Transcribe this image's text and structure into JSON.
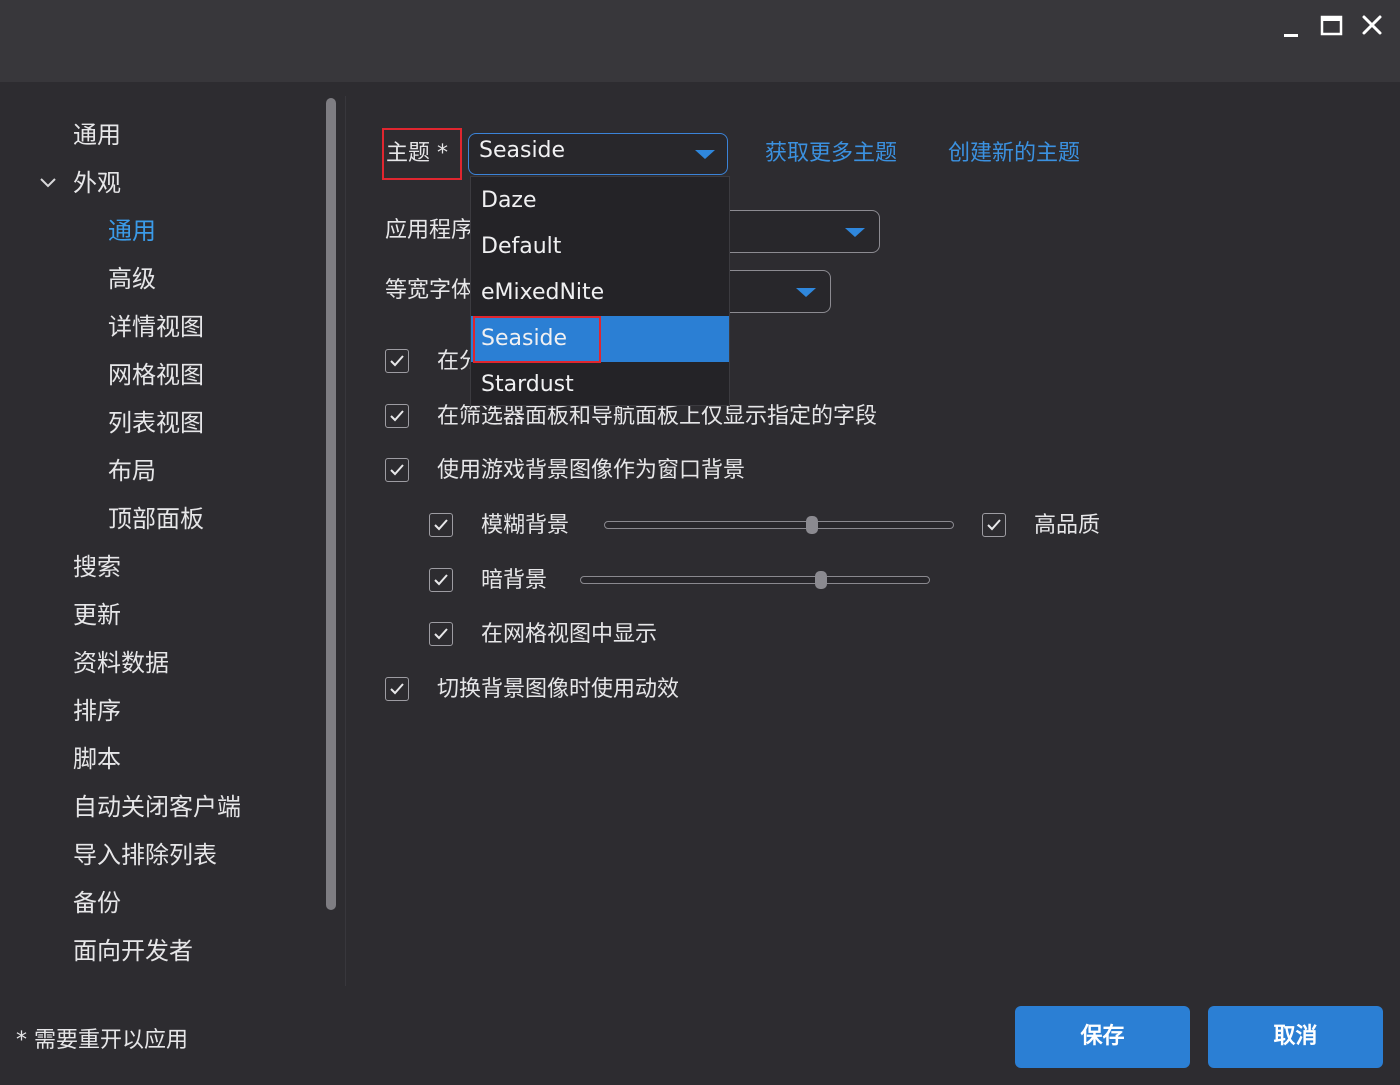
{
  "window": {
    "controls": {
      "minimize": "minimize-icon",
      "maximize": "maximize-icon",
      "close": "close-icon"
    }
  },
  "sidebar": {
    "items": [
      {
        "label": "通用"
      },
      {
        "label": "外观"
      },
      {
        "label": "通用"
      },
      {
        "label": "高级"
      },
      {
        "label": "详情视图"
      },
      {
        "label": "网格视图"
      },
      {
        "label": "列表视图"
      },
      {
        "label": "布局"
      },
      {
        "label": "顶部面板"
      },
      {
        "label": "搜索"
      },
      {
        "label": "更新"
      },
      {
        "label": "资料数据"
      },
      {
        "label": "排序"
      },
      {
        "label": "脚本"
      },
      {
        "label": "自动关闭客户端"
      },
      {
        "label": "导入排除列表"
      },
      {
        "label": "备份"
      },
      {
        "label": "面向开发者"
      }
    ],
    "active_item": "外观 › 通用"
  },
  "main": {
    "theme_label": "主题 *",
    "theme_value": "Seaside",
    "get_more_themes": "获取更多主题",
    "create_theme": "创建新的主题",
    "app_font_label": "应用程序",
    "mono_font_label": "等宽字体",
    "theme_options": [
      "Daze",
      "Default",
      "eMixedNite",
      "Seaside",
      "Stardust"
    ],
    "checkboxes": {
      "row1": "在分",
      "row2": "在筛选器面板和导航面板上仅显示指定的字段",
      "row3": "使用游戏背景图像作为窗口背景",
      "blur": "模糊背景",
      "high_quality": "高品质",
      "dark": "暗背景",
      "grid_show": "在网格视图中显示",
      "animate": "切换背景图像时使用动效"
    },
    "sliders": {
      "blur_level": 0.6,
      "dark_level": 0.69
    }
  },
  "footer": {
    "note": "* 需要重开以应用",
    "save": "保存",
    "cancel": "取消"
  },
  "colors": {
    "accent": "#2b7fd4",
    "highlight_border": "#e0262f",
    "background": "#2d2c30"
  }
}
